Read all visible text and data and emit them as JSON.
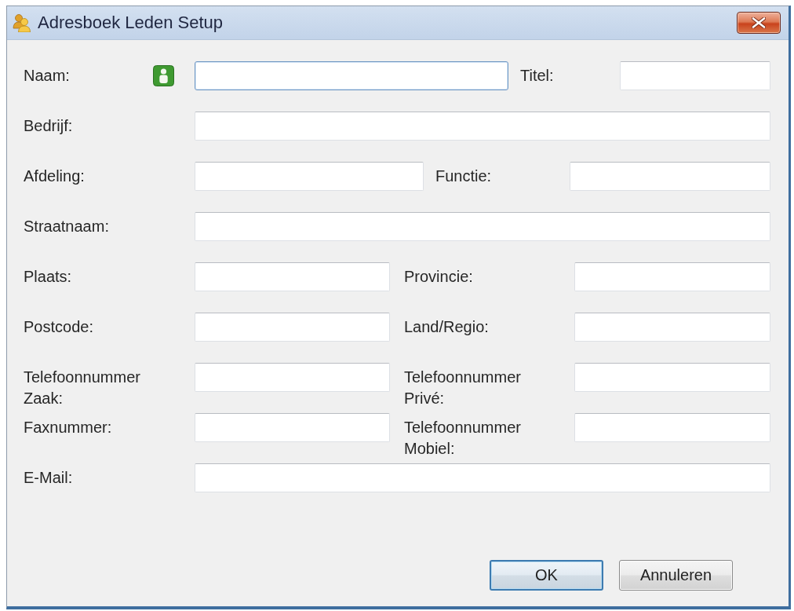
{
  "window": {
    "title": "Adresboek Leden Setup"
  },
  "rows": [
    {
      "kind": "name_title",
      "fields": [
        {
          "label": "Naam:",
          "focused": true
        },
        {
          "label": "Titel:",
          "focused": false
        }
      ]
    },
    {
      "kind": "single",
      "fields": [
        {
          "label": "Bedrijf:",
          "focused": false
        }
      ]
    },
    {
      "kind": "wide_pair",
      "fields": [
        {
          "label": "Afdeling:",
          "focused": false
        },
        {
          "label": "Functie:",
          "focused": false
        }
      ]
    },
    {
      "kind": "single",
      "fields": [
        {
          "label": "Straatnaam:",
          "focused": false
        }
      ]
    },
    {
      "kind": "pair",
      "fields": [
        {
          "label": "Plaats:",
          "focused": false
        },
        {
          "label": "Provincie:",
          "focused": false
        }
      ]
    },
    {
      "kind": "pair",
      "fields": [
        {
          "label": "Postcode:",
          "focused": false
        },
        {
          "label": "Land/Regio:",
          "focused": false
        }
      ]
    },
    {
      "kind": "pair",
      "fields": [
        {
          "label": "Telefoonnummer Zaak:",
          "focused": false
        },
        {
          "label": "Telefoonnummer Privé:",
          "focused": false
        }
      ]
    },
    {
      "kind": "pair",
      "fields": [
        {
          "label": "Faxnummer:",
          "focused": false
        },
        {
          "label": "Telefoonnummer Mobiel:",
          "focused": false
        }
      ]
    },
    {
      "kind": "single",
      "fields": [
        {
          "label": "E-Mail:",
          "focused": false
        }
      ]
    }
  ],
  "buttons": [
    {
      "label": "OK",
      "default": true
    },
    {
      "label": "Annuleren",
      "default": false
    }
  ]
}
